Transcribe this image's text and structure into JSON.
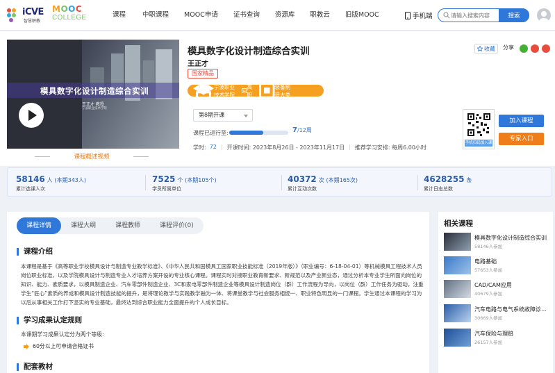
{
  "header": {
    "logo_brand": "iCVE",
    "logo_sub": "智慧职教",
    "logo2_top": "MOOC",
    "logo2_bottom": "COLLEGE",
    "nav": [
      "课程",
      "中职课程",
      "MOOC申请",
      "证书查询",
      "资源库",
      "职教云",
      "旧版MOOC"
    ],
    "mobile": "手机端",
    "search_placeholder": "请输入搜索内容",
    "search_button": "搜索"
  },
  "course": {
    "video_title": "模具数字化设计制造综合实训",
    "video_author": "王正才  教授",
    "video_school": "宁波职业技术学院",
    "video_caption": "课程概述视频",
    "title": "模具数字化设计制造综合实训",
    "teacher": "王正才",
    "badge": "国家精品",
    "school": "宁波职业技术学院",
    "level": "高职",
    "category": "装备制造大类",
    "semester": "第8期开课",
    "progress_label": "课程已进行至:",
    "progress_current": "7",
    "progress_total": "/12周",
    "progress_fraction": 0.58,
    "hours_label": "学时:",
    "hours_value": "72",
    "date_label": "开课时间: 2023年8月26日 - 2023年11月17日",
    "study_label": "推荐学习安排: 每周6.00小时",
    "favorite": "收藏",
    "share": "分享",
    "qr_label": "手机扫码加入课程",
    "join": "加入课程",
    "expert": "专家入口"
  },
  "stats": [
    {
      "num": "58146",
      "unit": "人",
      "extra": "(本期343人)",
      "label": "累计选课人次"
    },
    {
      "num": "7525",
      "unit": "个",
      "extra": "(本期105个)",
      "label": "学员所属单位"
    },
    {
      "num": "40372",
      "unit": "次",
      "extra": "(本期165次)",
      "label": "累计互动次数"
    },
    {
      "num": "4628255",
      "unit": "条",
      "extra": "",
      "label": "累计日志总数"
    }
  ],
  "tabs": [
    "课程详情",
    "课程大纲",
    "课程教师",
    "课程评价(0)"
  ],
  "intro": {
    "heading": "课程介绍",
    "text": "本课程是基于《高等职业学校模具设计与制造专业教学标准》、《中华人民共和国模具工国家职业技能标准（2019年版）》（职业编号：6-18-04-01）等机械模具工程技术人员岗位职业标准，以及学院模具设计与制造专业人才培养方案开设的专业核心课程。课程实时对接职业教育新要求、新规范以及产业新业态，通过分析本专业学生所面向岗位的知识、能力、素质要求，以模具制造企业、汽车零部件制造企业、3C和家电零部件制造企业等模具设计制造岗位（群）工作流程为导向，以岗位（群）工作任务为驱动，注重学生“匠心”素质的养成和模具设计制造技能的提升，是将理论教学与实践教学融为一体、将课堂教学与社会服务相统一、职业特色明显的一门课程。学生通过本课程的学习为以后从事相关工作打下坚实的专业基础，最终达到综合职业能力全面提升的个人成长目标。"
  },
  "rules": {
    "heading": "学习成果认定规则",
    "text": "本课期学习成果认定分为两个等级:",
    "item": "60分以上可申请合格证书"
  },
  "next_heading": "配套教材",
  "related": {
    "heading": "相关课程",
    "items": [
      {
        "title": "模具数字化设计制造综合实训",
        "sub": "58146人参加"
      },
      {
        "title": "电路基础",
        "sub": "57653人参加"
      },
      {
        "title": "CAD/CAM应用",
        "sub": "40679人参加"
      },
      {
        "title": "汽车电路与电气系统故障诊…",
        "sub": "30669人参加"
      },
      {
        "title": "汽车保险与理赔",
        "sub": "26157人参加"
      }
    ]
  }
}
